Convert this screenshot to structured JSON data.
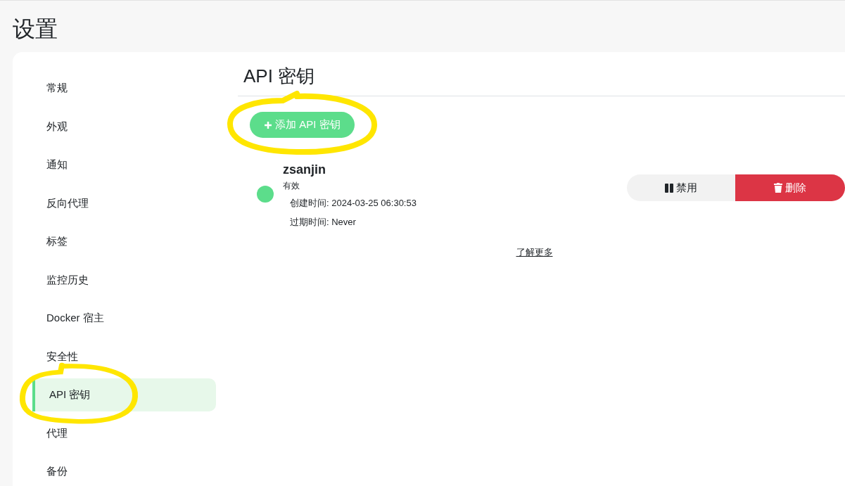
{
  "page_title": "设置",
  "sidebar": {
    "items": [
      {
        "label": "常规",
        "selected": false
      },
      {
        "label": "外观",
        "selected": false
      },
      {
        "label": "通知",
        "selected": false
      },
      {
        "label": "反向代理",
        "selected": false
      },
      {
        "label": "标签",
        "selected": false
      },
      {
        "label": "监控历史",
        "selected": false
      },
      {
        "label": "Docker 宿主",
        "selected": false
      },
      {
        "label": "安全性",
        "selected": false
      },
      {
        "label": "API 密钥",
        "selected": true
      },
      {
        "label": "代理",
        "selected": false
      },
      {
        "label": "备份",
        "selected": false
      }
    ]
  },
  "content": {
    "title": "API 密钥",
    "add_button": "添加 API 密钥",
    "keys": [
      {
        "name": "zsanjin",
        "status": "有效",
        "active": true,
        "created": "创建时间: 2024-03-25 06:30:53",
        "expires": "过期时间: Never",
        "disable_button": "禁用",
        "delete_button": "删除"
      }
    ],
    "learn_more": "了解更多"
  }
}
